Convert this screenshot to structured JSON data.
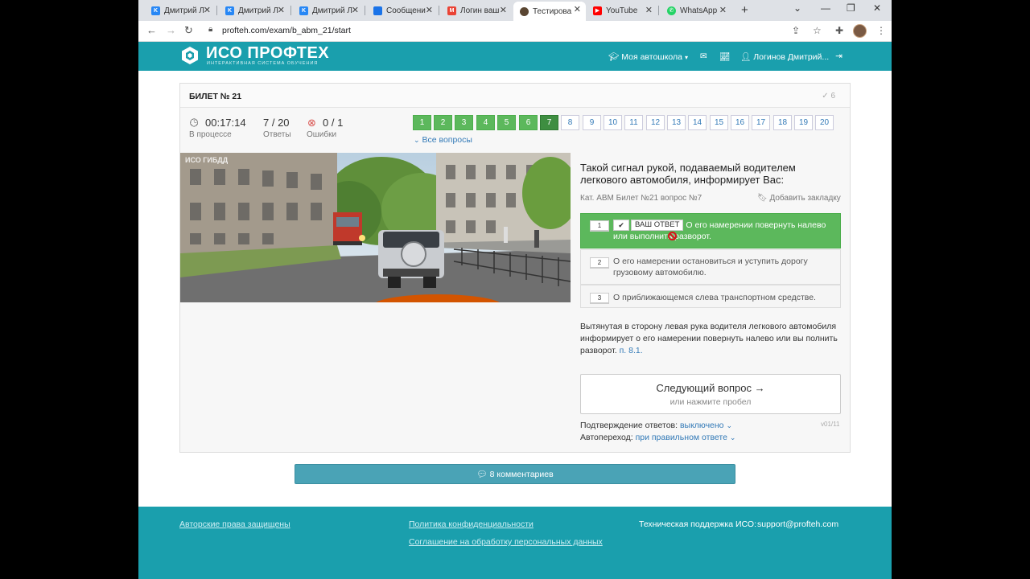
{
  "browser": {
    "tabs": [
      {
        "title": "Дмитрий Л",
        "icon_text": "K",
        "icon_color": "#2787f5"
      },
      {
        "title": "Дмитрий Л",
        "icon_text": "K",
        "icon_color": "#2787f5"
      },
      {
        "title": "Дмитрий Л",
        "icon_text": "K",
        "icon_color": "#2787f5"
      },
      {
        "title": "Сообщени",
        "icon_text": "",
        "icon_color": "#1a73e8"
      },
      {
        "title": "Логин ваш",
        "icon_text": "M",
        "icon_color": "#ea4335"
      },
      {
        "title": "Тестирова",
        "icon_text": "",
        "icon_color": "#5a4632"
      },
      {
        "title": "YouTube",
        "icon_text": "▶",
        "icon_color": "#ff0000"
      },
      {
        "title": "WhatsApp",
        "icon_text": "✆",
        "icon_color": "#25d366"
      }
    ],
    "url": "profteh.com/exam/b_abm_21/start"
  },
  "header": {
    "logo": "ИСО ПРОФТЕХ",
    "logo_sub": "ИНТЕРАКТИВНАЯ СИСТЕМА ОБУЧЕНИЯ",
    "school": "Моя автошкола",
    "user": "Логинов Дмитрий..."
  },
  "ticket": {
    "title": "БИЛЕТ № 21",
    "check_count": "✓ 6",
    "time": "00:17:14",
    "time_label": "В процессе",
    "answers": "7 / 20",
    "answers_label": "Ответы",
    "errors": "0 / 1",
    "errors_label": "Ошибки",
    "numbers": [
      "1",
      "2",
      "3",
      "4",
      "5",
      "6",
      "7",
      "8",
      "9",
      "10",
      "11",
      "12",
      "13",
      "14",
      "15",
      "16",
      "17",
      "18",
      "19",
      "20"
    ],
    "all_questions": "Все вопросы"
  },
  "question": {
    "text": "Такой сигнал рукой, подаваемый водителем легкового автомобиля, информирует Вас:",
    "meta": "Кат. ABM   Билет №21   вопрос №7",
    "bookmark": "Добавить закладку",
    "watermark": "ИСО   ГИБДД",
    "your_answer": "ВАШ ОТВЕТ",
    "answers": [
      {
        "num": "1",
        "text": "О его намерении повернуть налево или выполнить разворот."
      },
      {
        "num": "2",
        "text": "О его намерении остановиться и уступить дорогу грузовому автомобилю."
      },
      {
        "num": "3",
        "text": "О приближающемся слева транспортном средстве."
      }
    ],
    "explanation": "Вытянутая в сторону левая рука водителя легкового автомобиля информирует о его намерении повернуть налево или вы полнить разворот.",
    "explanation_ref": "п. 8.1.",
    "next_main": "Следующий вопрос →",
    "next_sub": "или нажмите пробел",
    "confirm_label": "Подтверждение ответов:",
    "confirm_value": "выключено",
    "auto_label": "Автопереход:",
    "auto_value": "при правильном ответе",
    "version": "v01/11"
  },
  "comments": "8 комментариев",
  "footer": {
    "copyright": "Авторские права защищены",
    "privacy": "Политика конфиденциальности",
    "agreement": "Соглашение на обработку персональных данных",
    "support_label": "Техническая поддержка ИСО:",
    "support_email": "support@profteh.com"
  }
}
